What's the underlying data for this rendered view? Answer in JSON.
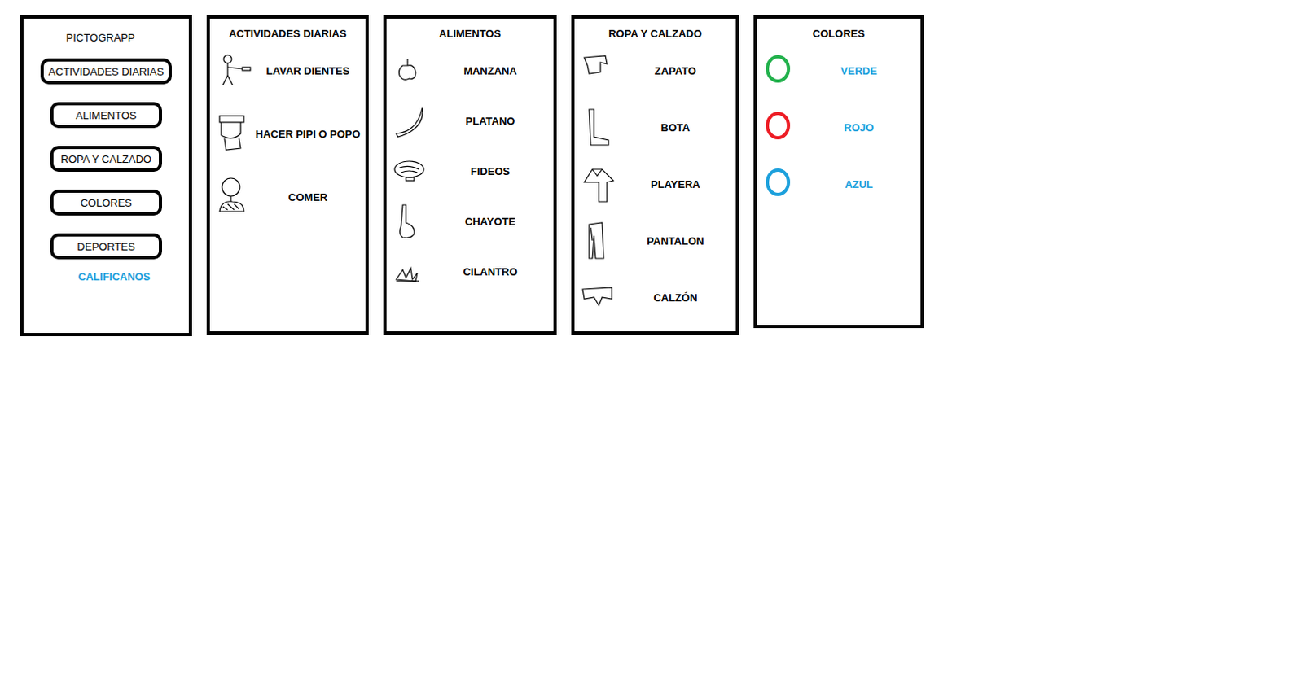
{
  "app": {
    "title": "PICTOGRAPP",
    "menu": [
      "ACTIVIDADES DIARIAS",
      "ALIMENTOS",
      "ROPA Y CALZADO",
      "COLORES",
      "DEPORTES"
    ],
    "rate_link": "CALIFICANOS"
  },
  "categories": [
    {
      "title": "ACTIVIDADES DIARIAS",
      "items": [
        {
          "label": "LAVAR DIENTES"
        },
        {
          "label": "HACER PIPI O POPO"
        },
        {
          "label": "COMER"
        }
      ]
    },
    {
      "title": "ALIMENTOS",
      "items": [
        {
          "label": "MANZANA"
        },
        {
          "label": "PLATANO"
        },
        {
          "label": "FIDEOS"
        },
        {
          "label": "CHAYOTE"
        },
        {
          "label": "CILANTRO"
        }
      ]
    },
    {
      "title": "ROPA Y CALZADO",
      "items": [
        {
          "label": "ZAPATO"
        },
        {
          "label": "BOTA"
        },
        {
          "label": "PLAYERA"
        },
        {
          "label": "PANTALON"
        },
        {
          "label": "CALZÓN"
        }
      ]
    },
    {
      "title": "COLORES",
      "items": [
        {
          "label": "VERDE",
          "color": "#22b14c"
        },
        {
          "label": "ROJO",
          "color": "#ed1c24"
        },
        {
          "label": "AZUL",
          "color": "#1ca0dc"
        }
      ]
    }
  ]
}
